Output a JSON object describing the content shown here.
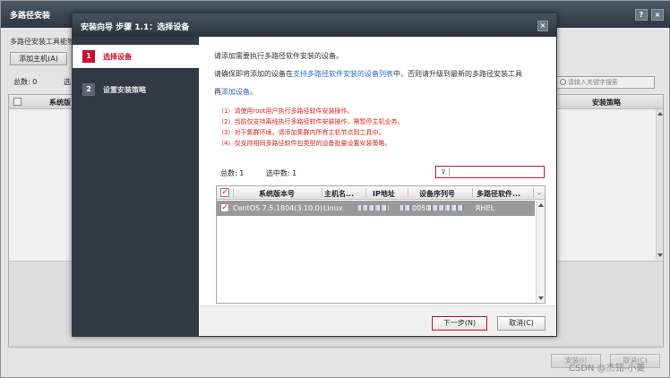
{
  "background": {
    "title": "多路径安装",
    "titlebar_buttons": [
      "?",
      "×"
    ],
    "description": "多路径安装工具能够",
    "add_host_label": "添加主机(A)",
    "total_label": "总数: 0",
    "selected_cut": "选",
    "search_placeholder": "请输入关键字搜索",
    "table_columns": [
      "系统版",
      "安装策略"
    ],
    "buttons": [
      "安装(I)",
      "取消(C)"
    ],
    "watermark": "CSDN @杰铭-小菱"
  },
  "dialog": {
    "title": "安装向导 步骤 1.1：选择设备",
    "close_label": "×",
    "steps": [
      {
        "num": "1",
        "label": "选择设备",
        "active": true
      },
      {
        "num": "2",
        "label": "设置安装策略",
        "active": false
      }
    ],
    "intro_line1": "请添加需要执行多路径软件安装的设备。",
    "intro_line2_a": "请确保即将添加的设备在",
    "intro_line2_link": "支持多路径软件安装的设备列表",
    "intro_line2_b": "中，否则请升级到最新的多路径安装工具",
    "intro_line3_a": "再",
    "intro_line3_link": "添加设备",
    "intro_line3_b": "。",
    "warnings": [
      "（1）请使用root用户执行多路径软件安装操作。",
      "（2）当前仅支持离线执行多路径软件安装操作，需暂停主机业务。",
      "（3）对于集群环境，请添加集群内所有主机节点到工具中。",
      "（4）仅支持相同多路径软件包类型的设备批量设置安装策略。"
    ],
    "total_label": "总数: 1",
    "selected_label": "选中数: 1",
    "table": {
      "columns": [
        "系统版本号",
        "主机名...",
        "IP地址",
        "设备序列号",
        "多路径软件..."
      ],
      "rows": [
        {
          "checked": true,
          "os_version": "CentOS 7.5.1804(3.10.0)",
          "hostname": "Linux",
          "serial_prefix": "0050",
          "multipath": "RHEL"
        }
      ]
    },
    "next_button": "下一步(N)",
    "cancel_button": "取消(C)"
  }
}
